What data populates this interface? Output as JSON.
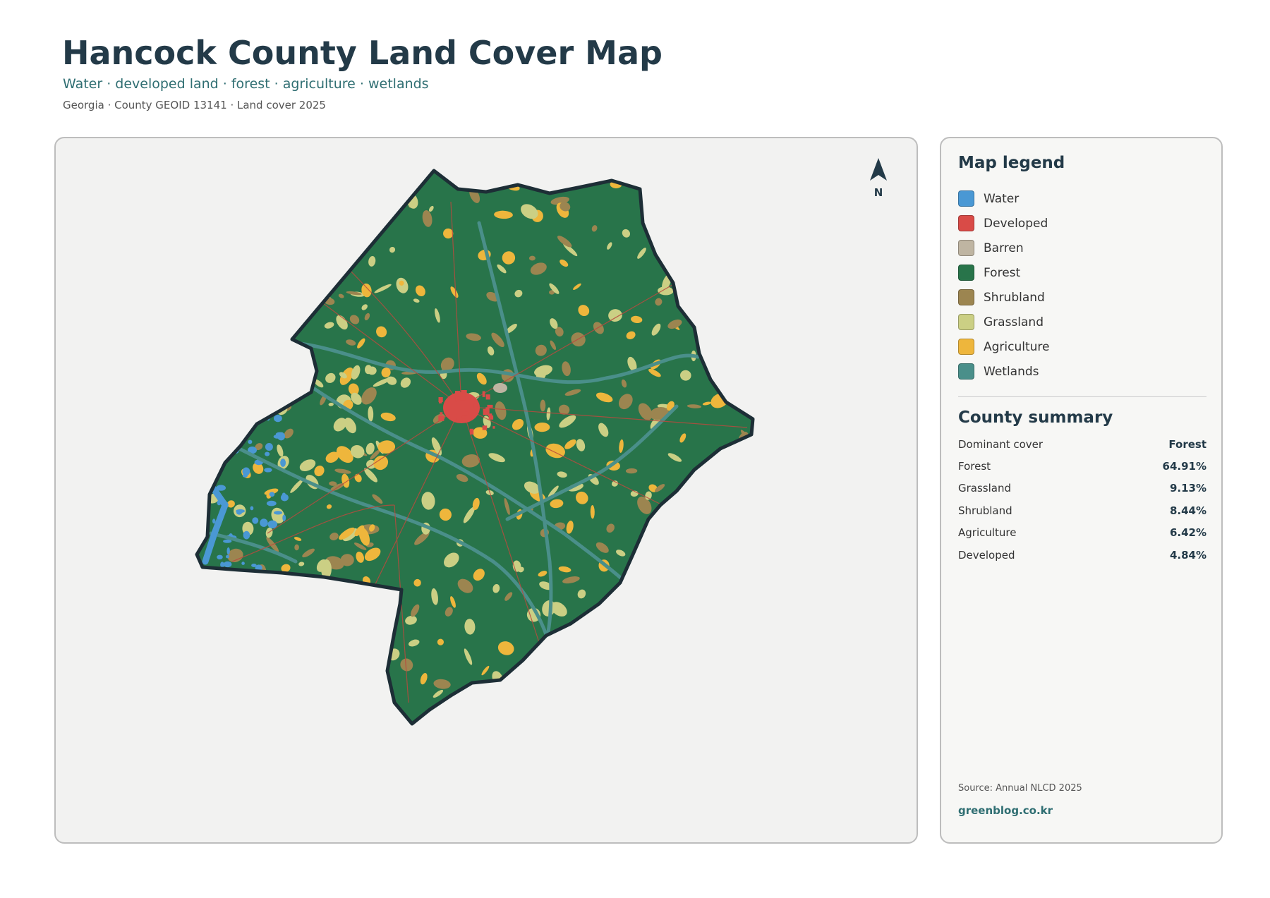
{
  "header": {
    "title": "Hancock County Land Cover Map",
    "subtitle": "Water · developed land · forest · agriculture · wetlands",
    "meta": "Georgia · County GEOID 13141 · Land cover 2025"
  },
  "map": {
    "north_label": "N",
    "colors": {
      "water": "#4a98d4",
      "developed": "#d94b47",
      "barren": "#bfb5a2",
      "forest": "#28744a",
      "shrubland": "#9c8550",
      "grassland": "#cbcf84",
      "agriculture": "#eeb63c",
      "wetlands": "#4a8f8a",
      "border": "#1d2e36",
      "road": "#b94a3e"
    }
  },
  "legend": {
    "title": "Map legend",
    "items": [
      {
        "label": "Water",
        "color": "#4a98d4"
      },
      {
        "label": "Developed",
        "color": "#d94b47"
      },
      {
        "label": "Barren",
        "color": "#bfb5a2"
      },
      {
        "label": "Forest",
        "color": "#28744a"
      },
      {
        "label": "Shrubland",
        "color": "#9c8550"
      },
      {
        "label": "Grassland",
        "color": "#cbcf84"
      },
      {
        "label": "Agriculture",
        "color": "#eeb63c"
      },
      {
        "label": "Wetlands",
        "color": "#4a8f8a"
      }
    ]
  },
  "summary": {
    "title": "County summary",
    "rows": [
      {
        "label": "Dominant cover",
        "value": "Forest"
      },
      {
        "label": "Forest",
        "value": "64.91%"
      },
      {
        "label": "Grassland",
        "value": "9.13%"
      },
      {
        "label": "Shrubland",
        "value": "8.44%"
      },
      {
        "label": "Agriculture",
        "value": "6.42%"
      },
      {
        "label": "Developed",
        "value": "4.84%"
      }
    ]
  },
  "footer": {
    "source": "Source: Annual NLCD 2025",
    "site": "greenblog.co.kr"
  }
}
